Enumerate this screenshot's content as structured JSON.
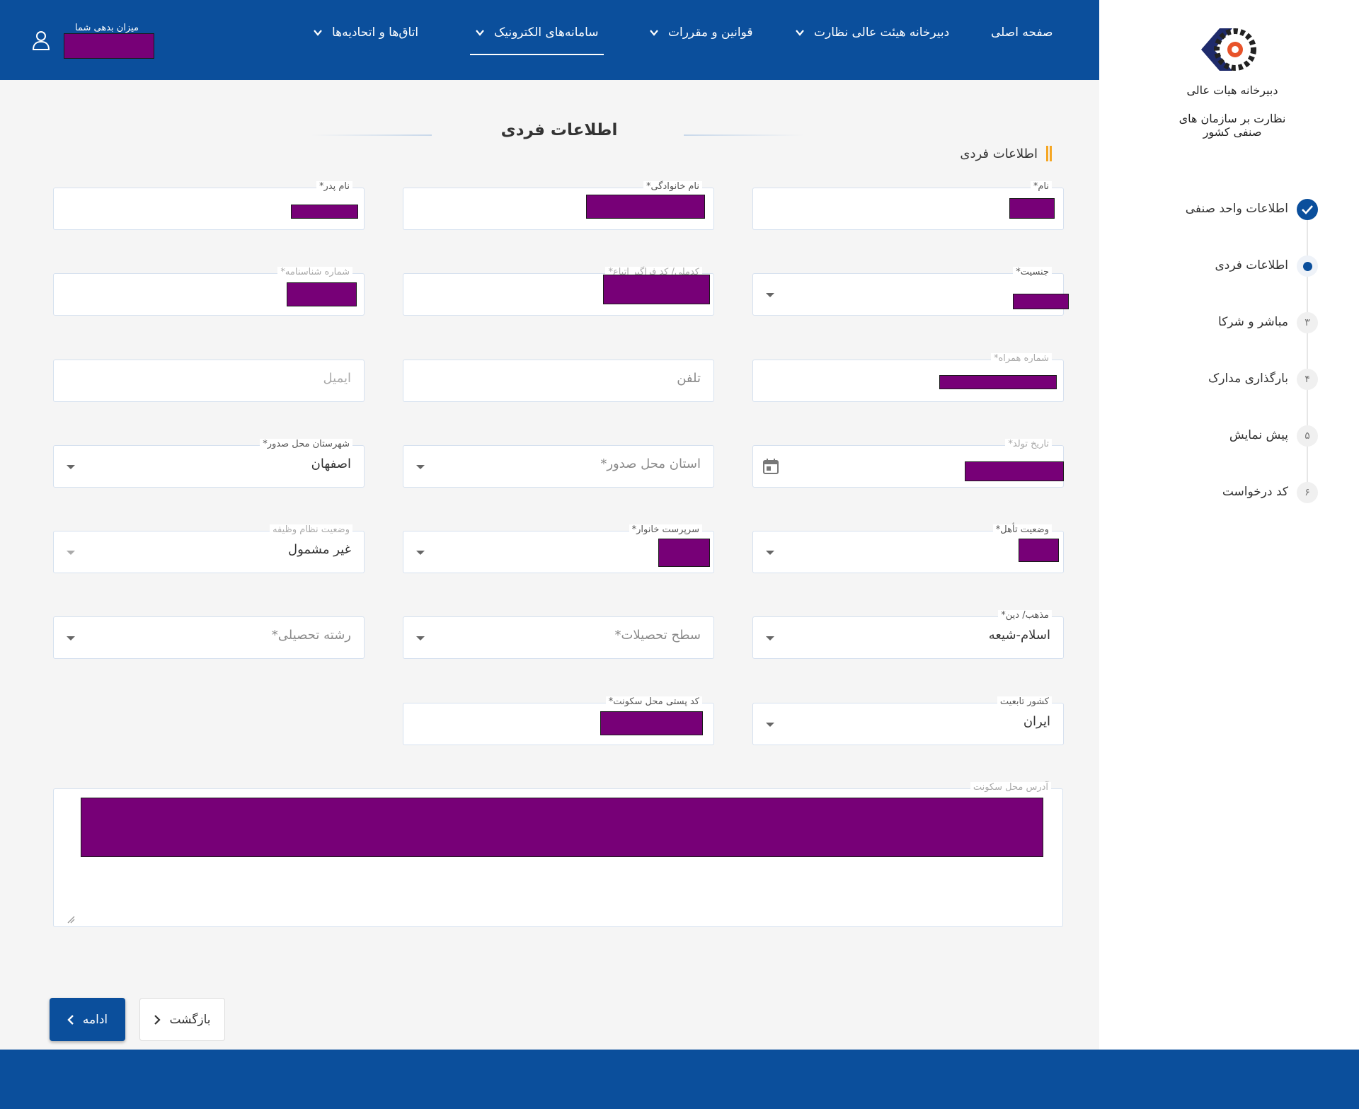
{
  "header": {
    "nav": [
      {
        "label": "صفحه اصلی",
        "has_dropdown": false,
        "active": false
      },
      {
        "label": "دبیرخانه هیئت عالی نظارت",
        "has_dropdown": true,
        "active": false
      },
      {
        "label": "قوانین و مقررات",
        "has_dropdown": true,
        "active": false
      },
      {
        "label": "سامانه‌های الکترونیک",
        "has_dropdown": true,
        "active": true
      },
      {
        "label": "اتاق‌ها و اتحادیه‌ها",
        "has_dropdown": true,
        "active": false
      }
    ],
    "debt_label": "میزان بدهی شما",
    "colors": {
      "primary": "#0b4f9c",
      "accent": "#f5a623",
      "redaction": "#770077"
    }
  },
  "sidebar": {
    "logo_line1": "دبیرخانه هیات عالی",
    "logo_line2": "نظارت بر سازمان های صنفی کشور",
    "steps": [
      {
        "number": "",
        "label": "اطلاعات واحد صنفی",
        "state": "done"
      },
      {
        "number": "",
        "label": "اطلاعات فردی",
        "state": "current"
      },
      {
        "number": "۳",
        "label": "مباشر و شرکا",
        "state": "pending"
      },
      {
        "number": "۴",
        "label": "بارگذاری مدارک",
        "state": "pending"
      },
      {
        "number": "۵",
        "label": "پیش نمایش",
        "state": "pending"
      },
      {
        "number": "۶",
        "label": "کد درخواست",
        "state": "pending"
      }
    ]
  },
  "main": {
    "page_title": "اطلاعات فردی",
    "section_title": "اطلاعات فردی",
    "fields": {
      "first_name": {
        "label": "نام*"
      },
      "last_name": {
        "label": "نام خانوادگی*"
      },
      "father_name": {
        "label": "نام پدر*"
      },
      "gender": {
        "label": "جنسیت*"
      },
      "national_code": {
        "label": "کدملی/ کد فراگیر اتباع*"
      },
      "id_number": {
        "label": "شماره شناسنامه*"
      },
      "mobile": {
        "label": "شماره همراه*"
      },
      "phone": {
        "placeholder": "تلفن"
      },
      "email": {
        "placeholder": "ایمیل"
      },
      "birth_date": {
        "label": "تاریخ تولد*"
      },
      "issue_province": {
        "placeholder": "استان محل صدور*"
      },
      "issue_city": {
        "label": "شهرستان محل صدور*",
        "value": "اصفهان"
      },
      "marital_status": {
        "label": "وضعیت تأهل*"
      },
      "head_of_household": {
        "label": "سرپرست خانوار*"
      },
      "military_status": {
        "label": "وضعیت نظام وظیفه",
        "value": "غیر مشمول"
      },
      "religion": {
        "label": "مذهب/ دین*",
        "value": "اسلام-شیعه"
      },
      "education_level": {
        "placeholder": "سطح تحصیلات*"
      },
      "field_of_study": {
        "placeholder": "رشته تحصیلی*"
      },
      "nationality": {
        "label": "کشور تابعیت",
        "value": "ایران"
      },
      "postal_code": {
        "label": "کد پستی محل سکونت*"
      },
      "address": {
        "label": "آدرس محل سکونت"
      }
    },
    "buttons": {
      "continue": "ادامه",
      "back": "بازگشت"
    }
  }
}
